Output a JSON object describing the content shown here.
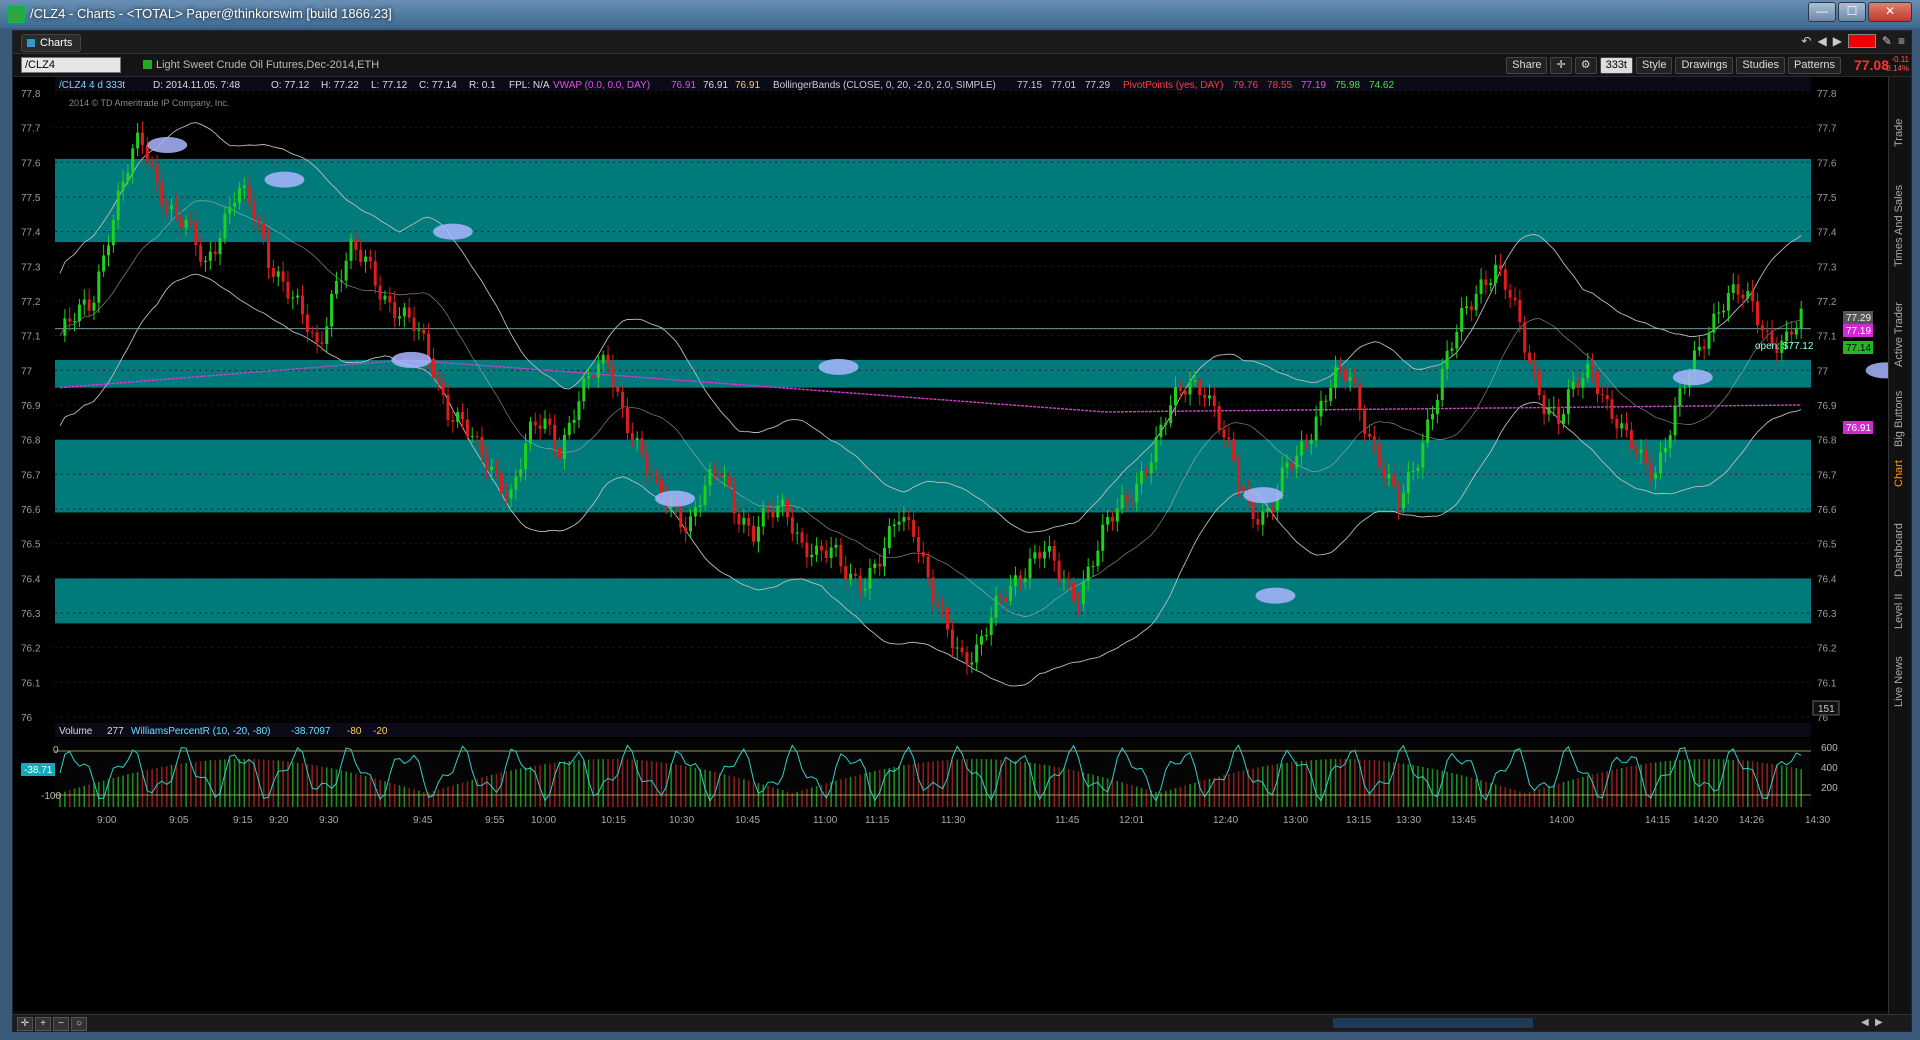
{
  "window": {
    "title": "/CLZ4 - Charts - <TOTAL> Paper@thinkorswim [build 1866.23]",
    "min_label": "—",
    "max_label": "☐",
    "close_label": "✕"
  },
  "tab": {
    "label": "Charts"
  },
  "symbol": {
    "value": "/CLZ4",
    "description": "Light Sweet Crude Oil Futures,Dec-2014,ETH"
  },
  "toolbar": {
    "share": "Share",
    "aggregation": "333t",
    "style": "Style",
    "drawings": "Drawings",
    "studies": "Studies",
    "patterns": "Patterns",
    "last_price": "77.08",
    "change_top": "-0.11",
    "change_pct": "-0.14%"
  },
  "status_line": {
    "ticker": "/CLZ4 4 d 333t",
    "date": "D: 2014.11.05. 7:48",
    "open": "O: 77.12",
    "high": "H: 77.22",
    "low": "L: 77.12",
    "close": "C: 77.14",
    "range": "R: 0.1",
    "fpl": "FPL: N/A",
    "vwap_label": "VWAP (0.0, 0.0, DAY)",
    "vwap_values": [
      "76.91",
      "76.91",
      "76.91"
    ],
    "bb_label": "BollingerBands (CLOSE, 0, 20, -2.0, 2.0, SIMPLE)",
    "bb_values": [
      "77.15",
      "77.01",
      "77.29"
    ],
    "pp_label": "PivotPoints (yes, DAY)",
    "pp_values": [
      "79.76",
      "78.55",
      "77.19",
      "75.98",
      "74.62"
    ]
  },
  "copyright": "2014 © TD Ameritrade IP Company, Inc.",
  "price_badges": {
    "upper": "77.29",
    "mid": "77.19",
    "last": "77.14",
    "vwap": "76.91"
  },
  "open_label": "open: $77.12",
  "bar_count": "151",
  "lower_status": {
    "volume_label": "Volume",
    "volume_value": "277",
    "wpr_label": "WilliamsPercentR (10, -20, -80)",
    "wpr_values": [
      "-38.7097",
      "-80",
      "-20"
    ],
    "wpr_badge": "-38.71",
    "left_ticks": [
      "0",
      "-100"
    ],
    "right_ticks": [
      "600",
      "400",
      "200"
    ]
  },
  "sidebar_tabs": [
    "Trade",
    "Times And Sales",
    "Active Trader",
    "Big Buttons",
    "Chart",
    "Dashboard",
    "Level II",
    "Live News"
  ],
  "colors": {
    "zone": "#007a7a",
    "up": "#1fd11f",
    "down": "#e01c1c",
    "vwap": "#d23cd2",
    "band": "#bdbdbd",
    "wpr": "#2fd0c8"
  },
  "chart_data": {
    "type": "candlestick",
    "ylim": [
      76.0,
      77.8
    ],
    "y_ticks": [
      "77.8",
      "77.7",
      "77.6",
      "77.5",
      "77.4",
      "77.3",
      "77.2",
      "77.1",
      "77",
      "76.9",
      "76.8",
      "76.7",
      "76.6",
      "76.5",
      "76.4",
      "76.3",
      "76.2",
      "76.1",
      "76"
    ],
    "x_ticks": [
      "9:00",
      "9:05",
      "9:15",
      "9:20",
      "9:30",
      "9:45",
      "9:55",
      "10:00",
      "10:15",
      "10:30",
      "10:45",
      "11:00",
      "11:15",
      "11:30",
      "11:45",
      "12:01",
      "12:40",
      "13:00",
      "13:15",
      "13:30",
      "13:45",
      "14:00",
      "14:15",
      "14:20",
      "14:26",
      "14:30"
    ],
    "zones": [
      [
        77.37,
        77.61
      ],
      [
        76.95,
        77.03
      ],
      [
        76.59,
        76.8
      ],
      [
        76.27,
        76.4
      ]
    ],
    "close_path": [
      77.1,
      77.15,
      77.2,
      77.4,
      77.55,
      77.67,
      77.55,
      77.45,
      77.4,
      77.3,
      77.42,
      77.52,
      77.45,
      77.32,
      77.25,
      77.15,
      77.05,
      77.25,
      77.35,
      77.3,
      77.22,
      77.18,
      77.12,
      77.02,
      76.9,
      76.85,
      76.75,
      76.7,
      76.65,
      76.8,
      76.85,
      76.78,
      76.9,
      76.98,
      77.03,
      76.88,
      76.75,
      76.65,
      76.62,
      76.55,
      76.65,
      76.72,
      76.6,
      76.52,
      76.58,
      76.62,
      76.5,
      76.45,
      76.48,
      76.42,
      76.38,
      76.45,
      76.6,
      76.55,
      76.35,
      76.25,
      76.18,
      76.2,
      76.3,
      76.38,
      76.45,
      76.48,
      76.4,
      76.35,
      76.45,
      76.55,
      76.62,
      76.7,
      76.78,
      76.9,
      76.98,
      76.95,
      76.82,
      76.7,
      76.6,
      76.58,
      76.7,
      76.78,
      76.88,
      76.97,
      76.98,
      76.85,
      76.72,
      76.6,
      76.72,
      76.88,
      77.02,
      77.15,
      77.25,
      77.3,
      77.2,
      77.05,
      76.92,
      76.85,
      76.95,
      77.02,
      76.9,
      76.8,
      76.75,
      76.72,
      76.85,
      76.98,
      77.1,
      77.2,
      77.22,
      77.18,
      77.1,
      77.08,
      77.14
    ],
    "bands": {
      "basis_offset": 0.18
    },
    "vwap": {
      "start": 76.95,
      "peak": 77.03,
      "low": 76.88,
      "end": 76.9
    },
    "lower_panel": {
      "wpr_range": [
        -100,
        0
      ],
      "volume_ylim": [
        0,
        600
      ]
    }
  }
}
